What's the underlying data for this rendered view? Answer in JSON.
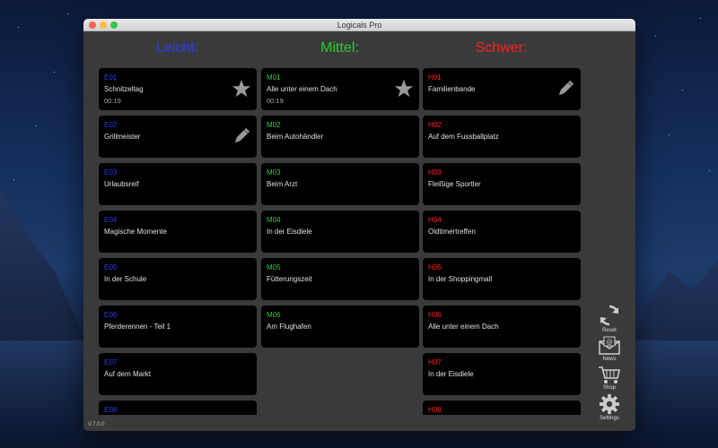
{
  "window": {
    "title": "Logicals Pro"
  },
  "headers": {
    "easy": "Leicht:",
    "mid": "Mittel:",
    "hard": "Schwer:"
  },
  "columns": {
    "easy": [
      {
        "code": "E01",
        "name": "Schnitzeltag",
        "time": "00:19",
        "icon": "star-icon"
      },
      {
        "code": "E02",
        "name": "Grillmeister",
        "time": "",
        "icon": "pencil-icon"
      },
      {
        "code": "E03",
        "name": "Urlaubsreif",
        "time": "",
        "icon": ""
      },
      {
        "code": "E04",
        "name": "Magische Momente",
        "time": "",
        "icon": ""
      },
      {
        "code": "E05",
        "name": "In der Schule",
        "time": "",
        "icon": ""
      },
      {
        "code": "E06",
        "name": "Pferderennen - Teil 1",
        "time": "",
        "icon": ""
      },
      {
        "code": "E07",
        "name": "Auf dem Markt",
        "time": "",
        "icon": ""
      },
      {
        "code": "E08",
        "name": "",
        "time": "",
        "icon": ""
      }
    ],
    "mid": [
      {
        "code": "M01",
        "name": "Alle unter einem Dach",
        "time": "00:19",
        "icon": "star-icon"
      },
      {
        "code": "M02",
        "name": "Beim Autohändler",
        "time": "",
        "icon": ""
      },
      {
        "code": "M03",
        "name": "Beim Arzt",
        "time": "",
        "icon": ""
      },
      {
        "code": "M04",
        "name": "In der Eisdiele",
        "time": "",
        "icon": ""
      },
      {
        "code": "M05",
        "name": "Fütterungszeit",
        "time": "",
        "icon": ""
      },
      {
        "code": "M06",
        "name": "Am Flughafen",
        "time": "",
        "icon": ""
      }
    ],
    "hard": [
      {
        "code": "H01",
        "name": "Familienbande",
        "time": "",
        "icon": "pencil-icon"
      },
      {
        "code": "H02",
        "name": "Auf dem Fussballplatz",
        "time": "",
        "icon": ""
      },
      {
        "code": "H03",
        "name": "Fleißige Sportler",
        "time": "",
        "icon": ""
      },
      {
        "code": "H04",
        "name": "Oldtimertreffen",
        "time": "",
        "icon": ""
      },
      {
        "code": "H05",
        "name": "In der Shoppingmall",
        "time": "",
        "icon": ""
      },
      {
        "code": "H06",
        "name": "Alle unter einem Dach",
        "time": "",
        "icon": ""
      },
      {
        "code": "H07",
        "name": "In der Eisdiele",
        "time": "",
        "icon": ""
      },
      {
        "code": "H08",
        "name": "",
        "time": "",
        "icon": ""
      }
    ]
  },
  "sidebar": {
    "reset": "Reset",
    "news": "News",
    "shop": "Shop",
    "settings": "Settings"
  },
  "version": "V.7.0.0",
  "colors": {
    "easy": "#2b3bff",
    "mid": "#2ecc2e",
    "hard": "#ff2020"
  }
}
